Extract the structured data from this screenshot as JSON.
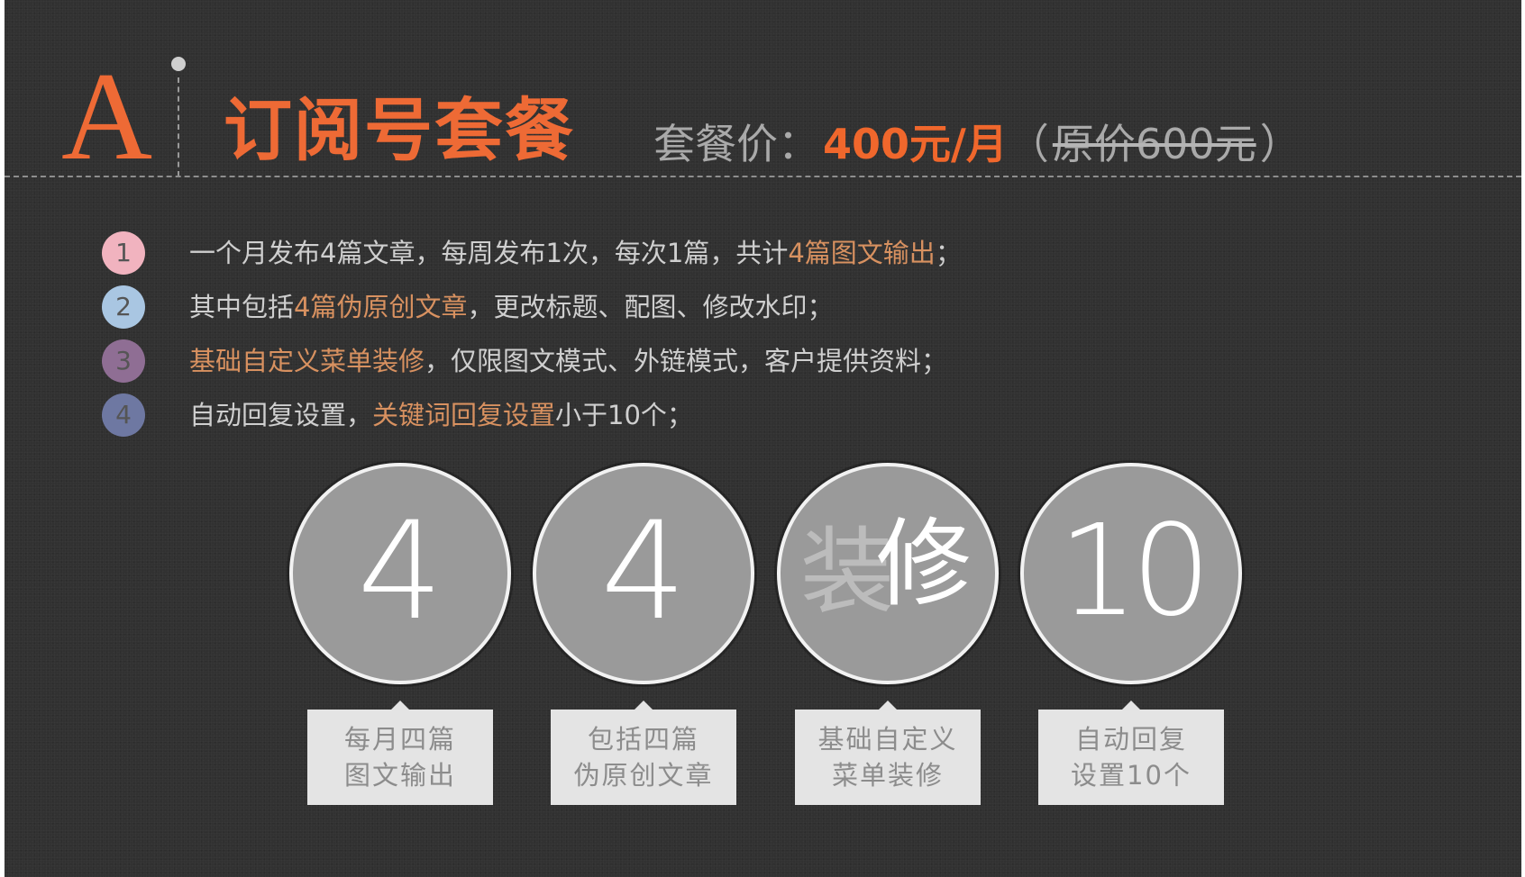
{
  "header": {
    "letter": "A",
    "title": "订阅号套餐",
    "price_label": "套餐价：",
    "price_value": "400元/月",
    "paren_open": "（",
    "original_price": "原价600元",
    "paren_close": "）"
  },
  "features": [
    {
      "num": "1",
      "color": "#f1b3bf",
      "parts": [
        {
          "t": "一个月发布4篇文章，每周发布1次，每次1篇，共计",
          "hl": false
        },
        {
          "t": "4篇图文输出",
          "hl": true
        },
        {
          "t": "；",
          "hl": false
        }
      ]
    },
    {
      "num": "2",
      "color": "#a9c6e2",
      "parts": [
        {
          "t": "其中包括",
          "hl": false
        },
        {
          "t": "4篇伪原创文章",
          "hl": true
        },
        {
          "t": "，更改标题、配图、修改水印；",
          "hl": false
        }
      ]
    },
    {
      "num": "3",
      "color": "#8f6e94",
      "parts": [
        {
          "t": "基础自定义菜单装修",
          "hl": true
        },
        {
          "t": "，仅限图文模式、外链模式，客户提供资料；",
          "hl": false
        }
      ]
    },
    {
      "num": "4",
      "color": "#6e78a2",
      "parts": [
        {
          "t": "自动回复设置，",
          "hl": false
        },
        {
          "t": "关键词回复设置",
          "hl": true
        },
        {
          "t": "小于10个；",
          "hl": false
        }
      ]
    }
  ],
  "circles": [
    {
      "value": "4",
      "label_line1": "每月四篇",
      "label_line2": "图文输出"
    },
    {
      "value": "4",
      "label_line1": "包括四篇",
      "label_line2": "伪原创文章"
    },
    {
      "value_faded": "装",
      "value_main": "修",
      "label_line1": "基础自定义",
      "label_line2": "菜单装修"
    },
    {
      "value": "10",
      "label_line1": "自动回复",
      "label_line2": "设置10个"
    }
  ],
  "colors": {
    "accent": "#ee6a35",
    "price": "#f0672c",
    "highlight": "#d89160",
    "background": "#313131"
  }
}
